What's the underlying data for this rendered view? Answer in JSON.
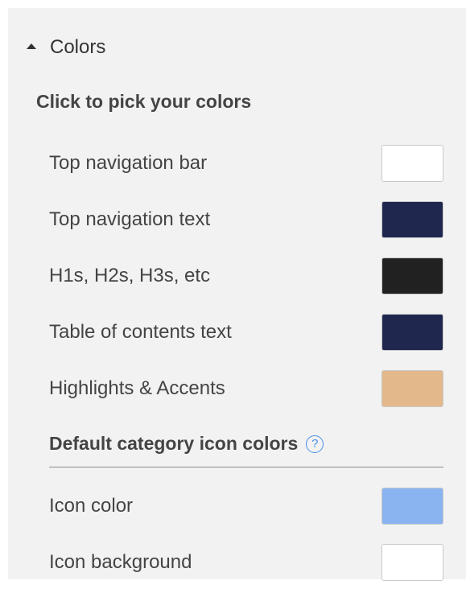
{
  "section": {
    "title": "Colors",
    "subheading": "Click to pick your colors"
  },
  "colors": [
    {
      "label": "Top navigation bar",
      "value": "#ffffff"
    },
    {
      "label": "Top navigation text",
      "value": "#1f274e"
    },
    {
      "label": "H1s, H2s, H3s, etc",
      "value": "#212121"
    },
    {
      "label": "Table of contents text",
      "value": "#1f274e"
    },
    {
      "label": "Highlights & Accents",
      "value": "#e3b98b"
    }
  ],
  "icon_section": {
    "heading": "Default category icon colors",
    "help_glyph": "?",
    "items": [
      {
        "label": "Icon color",
        "value": "#8ab4f0"
      },
      {
        "label": "Icon background",
        "value": "#ffffff"
      }
    ]
  },
  "icons": {
    "collapse": "caret-up-icon",
    "help": "help-circle-icon"
  }
}
